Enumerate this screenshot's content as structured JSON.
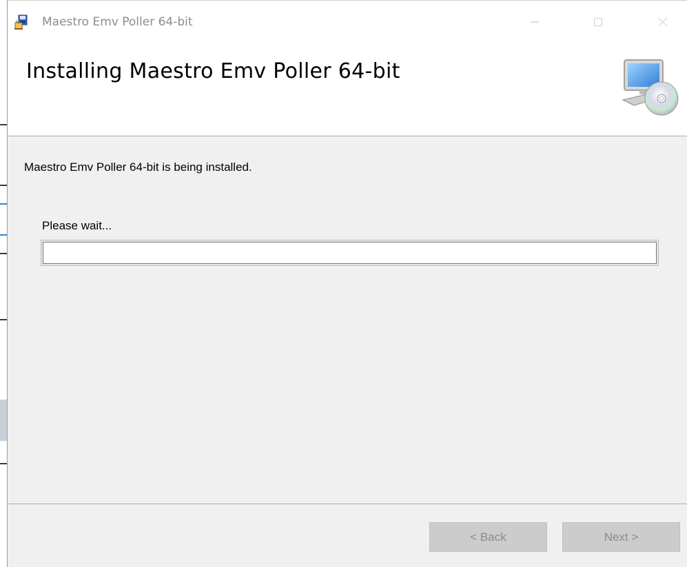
{
  "window": {
    "title": "Maestro Emv Poller 64-bit",
    "controls": [
      "minimize-icon",
      "maximize-icon",
      "close-icon"
    ]
  },
  "header": {
    "title": "Installing Maestro Emv Poller 64-bit",
    "icon": "computer-cd-icon"
  },
  "body": {
    "status": "Maestro Emv Poller 64-bit is being installed.",
    "wait_label": "Please wait...",
    "progress": 0
  },
  "footer": {
    "back_label": "< Back",
    "next_label": "Next >"
  },
  "colors": {
    "background": "#f0f0f0",
    "header_background": "#ffffff",
    "disabled_button": "#cccccc",
    "disabled_text": "#8a8a8a"
  }
}
